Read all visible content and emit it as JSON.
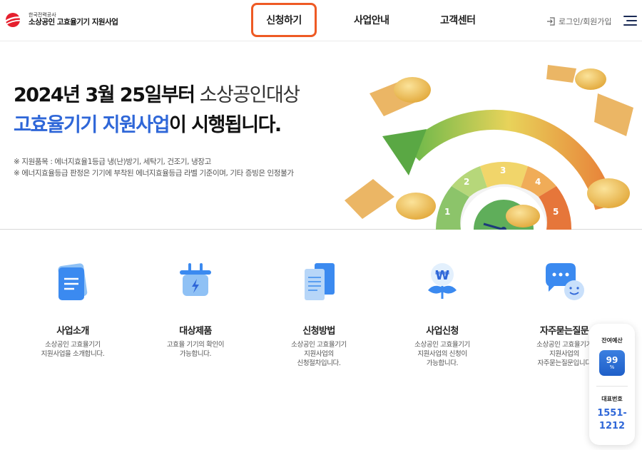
{
  "header": {
    "logo_small": "한국전력공사",
    "logo_main": "소상공인 고효율기기 지원사업",
    "nav": {
      "apply": "신청하기",
      "info": "사업안내",
      "support": "고객센터"
    },
    "login": "로그인/회원가입",
    "accent_color": "#ee5a24"
  },
  "hero": {
    "title_line1_bold": "2024년 3월 25일부터",
    "title_line1_light": " 소상공인대상",
    "title_line2_blue": "고효율기기 지원사업",
    "title_line2_rest": "이 시행됩니다.",
    "notes": [
      "※ 지원품목 : 에너지효율1등급 냉(난)방기, 세탁기, 건조기, 냉장고",
      "※ 에너지효율등급 판정은 기기에 부착된 에너지효율등급 라벨 기준이며, 기타 증빙은 인정불가"
    ],
    "gauge_labels": [
      "1",
      "2",
      "3",
      "4",
      "5"
    ]
  },
  "cards": [
    {
      "title": "사업소개",
      "desc": "소상공인 고효율기기\n지원사업을 소개합니다.",
      "icon": "document-icon"
    },
    {
      "title": "대상제품",
      "desc": "고효율 기기의 확인이\n가능합니다.",
      "icon": "plug-icon"
    },
    {
      "title": "신청방법",
      "desc": "소상공인 고효율기기\n지원사업의\n신청절차입니다.",
      "icon": "files-icon"
    },
    {
      "title": "사업신청",
      "desc": "소상공인 고효율기기\n지원사업의 신청이\n가능합니다.",
      "icon": "won-plant-icon"
    },
    {
      "title": "자주묻는질문",
      "desc": "소상공인 고효율기기\n지원사업의\n자주묻는질문입니다",
      "icon": "chat-bubble-icon"
    }
  ],
  "widget": {
    "budget_label": "잔여예산",
    "budget_value": "99",
    "budget_unit": "%",
    "phone_label": "대표번호",
    "phone": "1551-\n1212"
  }
}
